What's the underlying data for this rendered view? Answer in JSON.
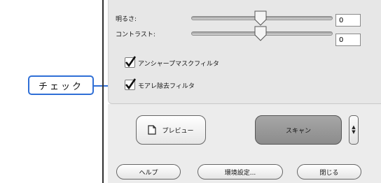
{
  "sliders": [
    {
      "label": "明るさ:",
      "value": "0"
    },
    {
      "label": "コントラスト:",
      "value": "0"
    }
  ],
  "checkboxes": [
    {
      "label": "アンシャープマスクフィルタ",
      "checked": true
    },
    {
      "label": "モアレ除去フィルタ",
      "checked": true
    }
  ],
  "buttons": {
    "preview": "プレビュー",
    "scan": "スキャン",
    "help": "ヘルプ",
    "settings": "環境設定...",
    "close": "閉じる"
  },
  "callout": {
    "label": "チェック",
    "color": "#2f6fd6"
  },
  "icons": {
    "preview": "document-icon",
    "stepper": "up-down-arrows-icon",
    "check": "checkmark-icon"
  }
}
